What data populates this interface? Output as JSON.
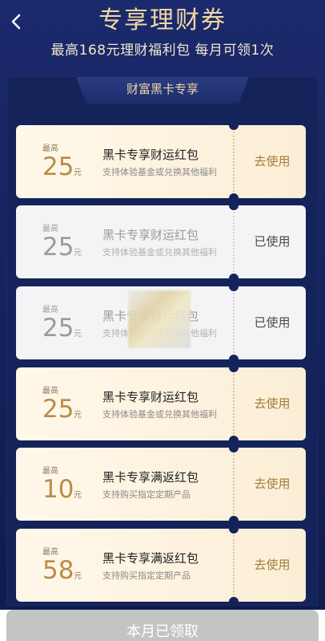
{
  "header": {
    "title": "专享理财券",
    "subtitle": "最高168元理财福利包 每月可领1次"
  },
  "section": {
    "label": "财富黑卡专享"
  },
  "coupons": [
    {
      "state": "active",
      "max_label": "最高",
      "amount": "25",
      "unit": "元",
      "name": "黑卡专享财运红包",
      "desc": "支持体验基金或兑换其他福利",
      "action": "去使用"
    },
    {
      "state": "used",
      "max_label": "最高",
      "amount": "25",
      "unit": "元",
      "name": "黑卡专享财运红包",
      "desc": "支持体验基金或兑换其他福利",
      "action": "已使用"
    },
    {
      "state": "used",
      "max_label": "最高",
      "amount": "25",
      "unit": "元",
      "name": "黑卡专享财运红包",
      "desc": "支持体验基金或兑换其他福利",
      "action": "已使用"
    },
    {
      "state": "active",
      "max_label": "最高",
      "amount": "25",
      "unit": "元",
      "name": "黑卡专享财运红包",
      "desc": "支持体验基金或兑换其他福利",
      "action": "去使用"
    },
    {
      "state": "active",
      "max_label": "最高",
      "amount": "10",
      "unit": "元",
      "name": "黑卡专享满返红包",
      "desc": "支持购买指定定期产品",
      "action": "去使用"
    },
    {
      "state": "active",
      "max_label": "最高",
      "amount": "58",
      "unit": "元",
      "name": "黑卡专享满返红包",
      "desc": "支持购买指定定期产品",
      "action": "去使用"
    }
  ],
  "footer": {
    "button": "本月已领取"
  },
  "icons": {
    "back": "back-chevron-icon"
  },
  "colors": {
    "gold": "#f1d6a2",
    "navy": "#14235a",
    "accent": "#b98c4a"
  }
}
